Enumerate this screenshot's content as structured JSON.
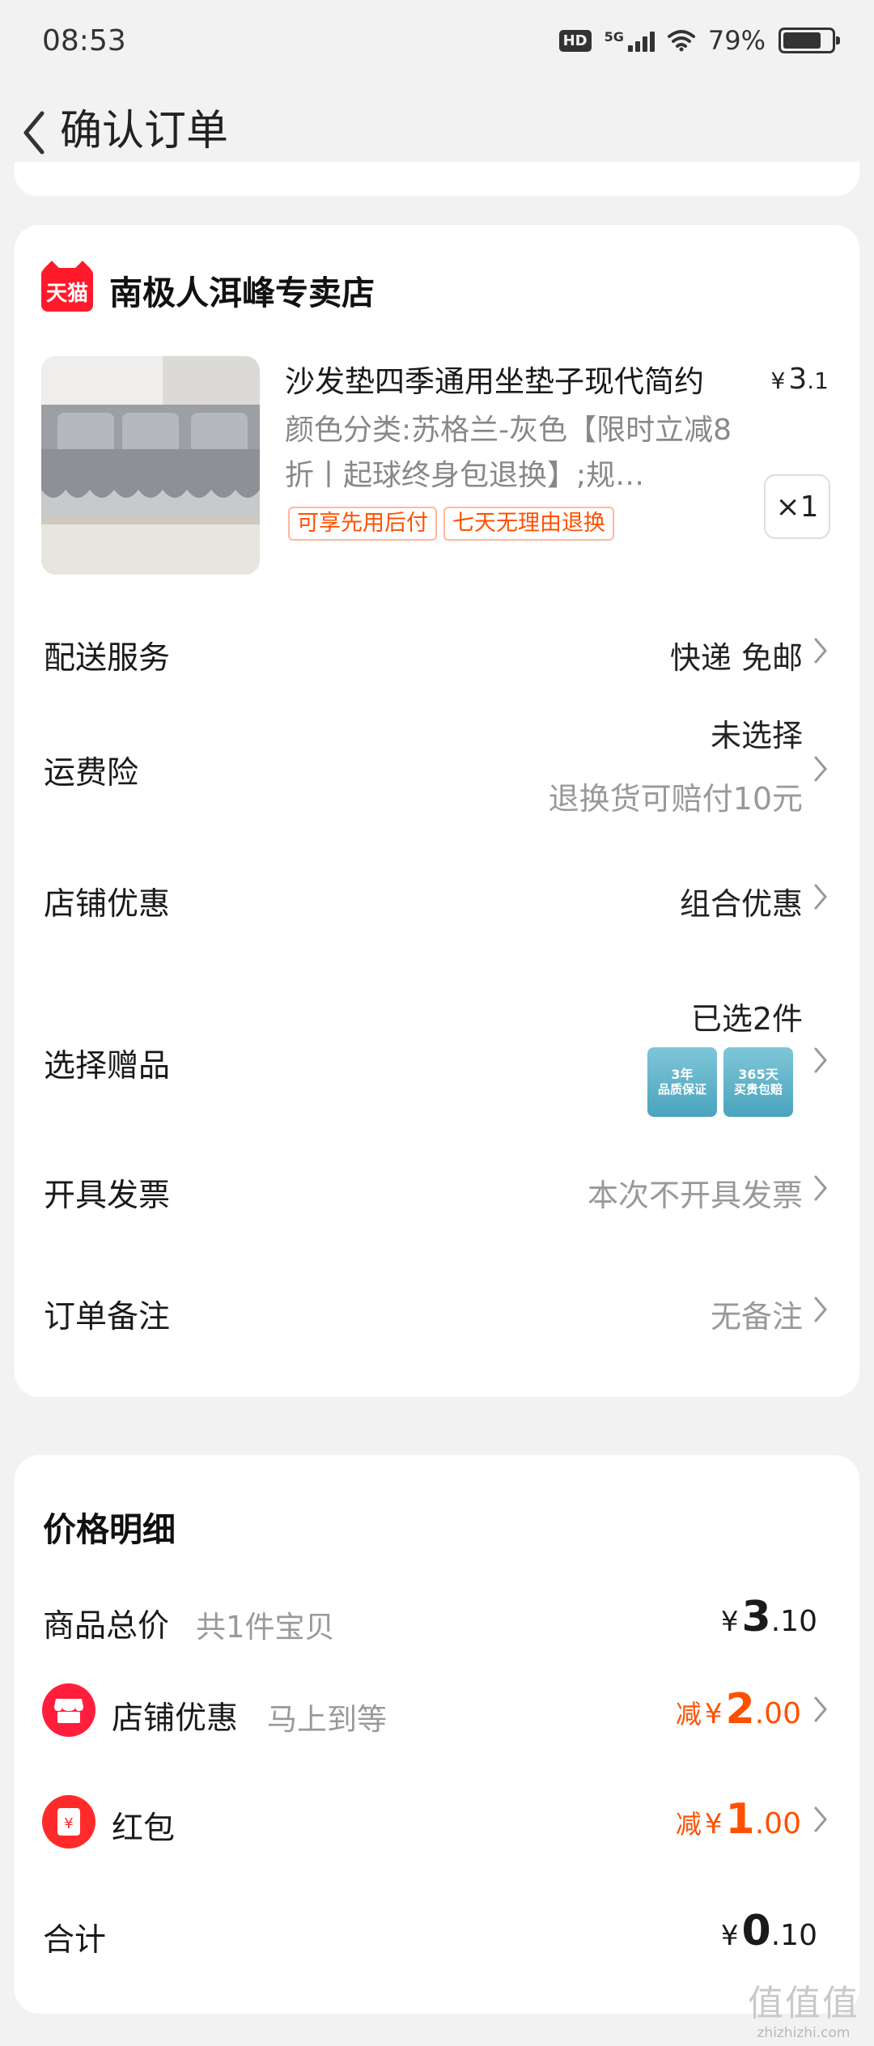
{
  "status_bar": {
    "time": "08:53",
    "hd": "HD",
    "network": "5G",
    "battery": "79%",
    "battery_level": 0.79
  },
  "nav": {
    "title": "确认订单"
  },
  "order": {
    "store": {
      "logo_text": "天猫",
      "name": "南极人洱峰专卖店"
    },
    "product": {
      "title": "沙发垫四季通用坐垫子现代简约",
      "price_yen": "¥",
      "price_int": "3",
      "price_dec": ".1",
      "sku": "颜色分类:苏格兰-灰色【限时立减8折丨起球终身包退换】;规…",
      "tags": [
        "可享先用后付",
        "七天无理由退换"
      ],
      "qty": "×1"
    },
    "rows": {
      "delivery": {
        "label": "配送服务",
        "value": "快递 免邮"
      },
      "freight_insurance": {
        "label": "运费险",
        "value": "未选择",
        "sub": "退换货可赔付10元"
      },
      "store_discount": {
        "label": "店铺优惠",
        "value": "组合优惠"
      },
      "gift": {
        "label": "选择赠品",
        "value": "已选2件",
        "thumbs": [
          {
            "line1": "3年",
            "line2": "品质保证"
          },
          {
            "line1": "365天",
            "line2": "买贵包赔"
          }
        ]
      },
      "invoice": {
        "label": "开具发票",
        "value": "本次不开具发票"
      },
      "remark": {
        "label": "订单备注",
        "value": "无备注"
      }
    }
  },
  "price_detail": {
    "title": "价格明细",
    "goods_total": {
      "label": "商品总价",
      "sub": "共1件宝贝",
      "yen": "¥",
      "int": "3",
      "dec": ".10"
    },
    "store_discount": {
      "label": "店铺优惠",
      "sub": "马上到等",
      "prefix": "减",
      "yen": "¥",
      "int": "2",
      "dec": ".00"
    },
    "red_packet": {
      "label": "红包",
      "prefix": "减",
      "yen": "¥",
      "int": "1",
      "dec": ".00"
    },
    "total": {
      "label": "合计",
      "yen": "¥",
      "int": "0",
      "dec": ".10"
    }
  },
  "watermark": {
    "glyphs": "值值值",
    "url": "zhizhizhi.com"
  },
  "colors": {
    "accent": "#ff5000",
    "tmall_red": "#ff1a2b",
    "background": "#f2f2f2"
  }
}
